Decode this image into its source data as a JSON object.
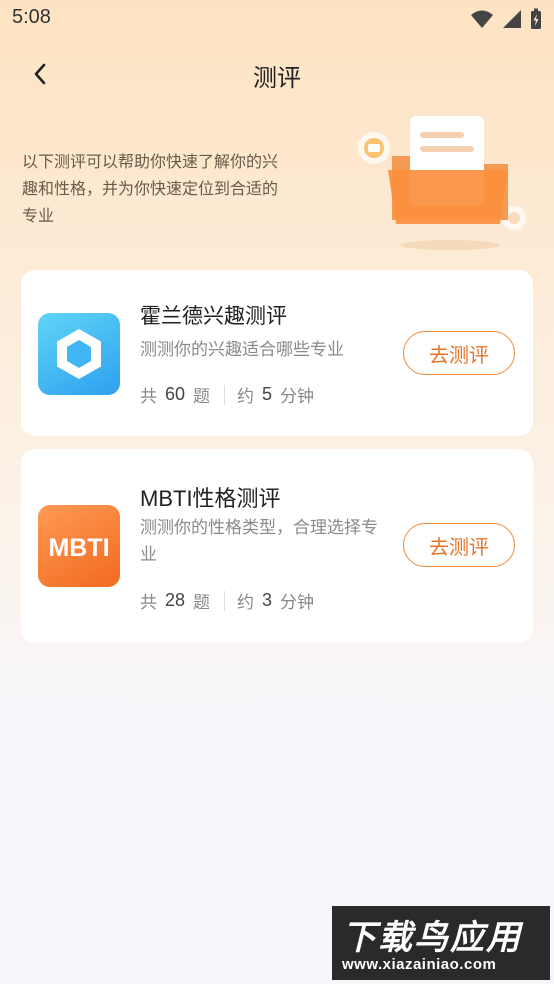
{
  "status_bar": {
    "time": "5:08"
  },
  "nav": {
    "title": "测评"
  },
  "intro": {
    "text": "以下测评可以帮助你快速了解你的兴趣和性格，并为你快速定位到合适的专业"
  },
  "tests": [
    {
      "title": "霍兰德兴趣测评",
      "desc": "测测你的兴趣适合哪些专业",
      "count_prefix": "共",
      "count": "60",
      "count_suffix": "题",
      "time_prefix": "约",
      "time": "5",
      "time_suffix": "分钟",
      "button": "去测评"
    },
    {
      "title": "MBTI性格测评",
      "desc": "测测你的性格类型，合理选择专业",
      "icon_text": "MBTI",
      "count_prefix": "共",
      "count": "28",
      "count_suffix": "题",
      "time_prefix": "约",
      "time": "3",
      "time_suffix": "分钟",
      "button": "去测评"
    }
  ],
  "watermark": {
    "line1": "下载鸟应用",
    "line2": "www.xiazainiao.com"
  },
  "colors": {
    "accent": "#e8742a",
    "card_bg": "#ffffff",
    "header_bg": "#fde3c2"
  }
}
